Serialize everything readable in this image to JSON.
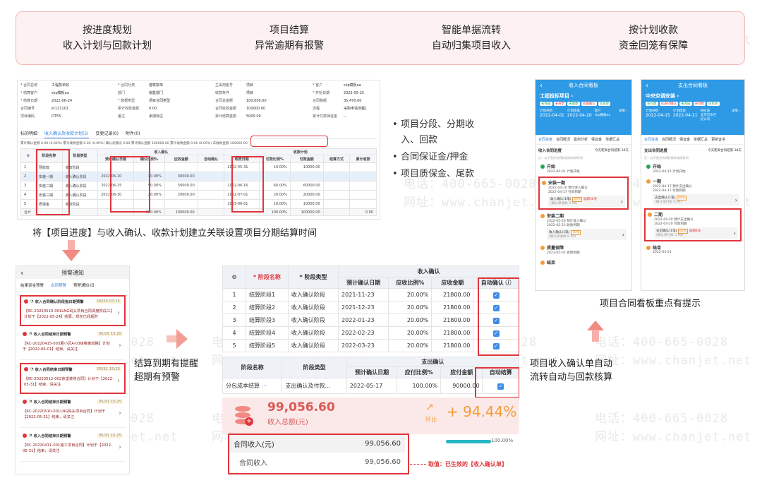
{
  "watermark": {
    "phone": "电话：400-665-0028",
    "site": "网址：www.chanjet.net"
  },
  "banner": {
    "features": [
      {
        "title": "按进度规划",
        "subtitle": "收入计划与回款计划"
      },
      {
        "title": "项目结算",
        "subtitle": "异常逾期有报警"
      },
      {
        "title": "智能单据流转",
        "subtitle": "自动归集项目收入"
      },
      {
        "title": "按计划收款",
        "subtitle": "资金回笼有保障"
      }
    ]
  },
  "contract_form": {
    "fields": [
      {
        "label": "* 合同名称",
        "value": "工程款单收"
      },
      {
        "label": "* 合同分类",
        "value": "建筑款单"
      },
      {
        "label": "主采用客号",
        "value": "项目"
      },
      {
        "label": "* 客户",
        "value": "skp模板aa"
      },
      {
        "label": "* 结算客户",
        "value": "skp模板aa"
      },
      {
        "label": "部门",
        "value": "销售部门"
      },
      {
        "label": "收款条件",
        "value": "项目"
      },
      {
        "label": "* 开始日期",
        "value": "2022-05-25"
      },
      {
        "label": "* 结算日期",
        "value": "2022-06-24"
      },
      {
        "label": "* 数据类型",
        "value": "项目合同类型"
      },
      {
        "label": "合同总金额",
        "value": "100,000.00"
      },
      {
        "label": "合同税额",
        "value": "35,470.00"
      },
      {
        "label": "合同编号",
        "value": "kt121101"
      },
      {
        "label": "累计收款金额",
        "value": "0.00"
      },
      {
        "label": "合同收款金额",
        "value": "100000.00"
      },
      {
        "label": "流程",
        "value": "采购申请流程1"
      },
      {
        "label": "项目编码",
        "value": "DT55"
      },
      {
        "label": "备注",
        "value": "添加标注"
      },
      {
        "label": "累计结算金额",
        "value": "5000.00"
      },
      {
        "label": "累计付款保证金",
        "value": "--"
      }
    ],
    "tabs": [
      "标的明细",
      "收入确认及收款计划(5)",
      "变更记录(0)",
      "附件(0)"
    ],
    "summary": "累计确认金额 0.00 (0.00%)  累计收款金额 0.00 (0.00%)  确认总额比 0.00  累计确认金额 100000.00  累计收款金额 0.00 (0.00%)  未收款金额 100000.00",
    "group_headers": {
      "confirm": "收入确认",
      "plan": "收款计划"
    },
    "columns": [
      "阶段名称",
      "阶段类型",
      "预计确认日期",
      "确认比例%",
      "应收金额",
      "自动确认",
      "收款日期",
      "付款比例%",
      "付款金额",
      "结算方式",
      "累计收款"
    ],
    "rows": [
      {
        "idx": "1",
        "name": "预收款",
        "type": "收款阶段",
        "date": "",
        "ratio": "",
        "amount": "",
        "pdate": "2022-05-31",
        "pratio": "10.00%",
        "pamount": "10000.00"
      },
      {
        "idx": "2",
        "name": "安装一期",
        "type": "收入确认阶段",
        "date": "2022-06-10",
        "ratio": "30.00%",
        "amount": "30000.00",
        "pdate": "",
        "pratio": "",
        "pamount": ""
      },
      {
        "idx": "3",
        "name": "安装二期",
        "type": "收入确认阶段",
        "date": "2022-06-15",
        "ratio": "50.00%",
        "amount": "50000.00",
        "pdate": "2022-06-16",
        "pratio": "60.00%",
        "pamount": "60000.00"
      },
      {
        "idx": "4",
        "name": "安装三期",
        "type": "收入确认阶段",
        "date": "2022-06-30",
        "ratio": "20.00%",
        "amount": "20000.00",
        "pdate": "2022-07-01",
        "pratio": "20.00%",
        "pamount": "20000.00"
      },
      {
        "idx": "5",
        "name": "质保金",
        "type": "收款阶段",
        "date": "",
        "ratio": "",
        "amount": "",
        "pdate": "2023-06-01",
        "pratio": "10.00%",
        "pamount": "10000.00"
      }
    ],
    "totals": {
      "label": "合计",
      "ratio": "100.00%",
      "amount": "100000.00",
      "pratio": "100.00%",
      "pamount": "100000.00",
      "received": "0.00"
    }
  },
  "bullets": [
    "项目分段、分期收入、回款",
    "合同保证金/押金",
    "项目质保金、尾款"
  ],
  "caption_link": "将【项目进度】与收入确认、收款计划建立关联设置项目分期结算时间",
  "alert_panel": {
    "title": "预警通知",
    "tabs": [
      "结果资金预警",
      "合同预警",
      "预警通知-旧"
    ],
    "items": [
      {
        "title": "收入合同确认阶段指日期预警",
        "time": "05/25 07:15",
        "body": "【RC-20220510-001LNG码头项目合同调度阶段二】计划于【2022-05-24】结算，现在已经超时"
      },
      {
        "title": "收入合同结束日期预警",
        "time": "05/25 15:25",
        "body": "【RC-20220415-003展小区A-03级楼盘道路】计划于【2022-06-01】结束，请关注"
      },
      {
        "title": "收入合同结束日期预警",
        "time": "05/31 15:25",
        "body": "【RC-20220512-002食堂装修合同】计划于【2022-05-31】结束，请关注"
      },
      {
        "title": "收入合同结束日期预警",
        "time": "05/31 15:25",
        "body": "【RC-20220510-001LNG码头项目合同】计划于【2022-05-31】结束，请关注"
      },
      {
        "title": "收入合同结束日期预警",
        "time": "05/31 15:25",
        "body": "【RC-20220411-001施工项目合同】计划于【2022-05-31】结束，请关注"
      }
    ]
  },
  "caption_alert": [
    "结算到期有提醒",
    "超期有预警"
  ],
  "income_table": {
    "group_header": "收入确认",
    "columns": [
      "阶段名称",
      "阶段类型",
      "预计确认日期",
      "应收比例%",
      "应收金额",
      "自动确认"
    ],
    "rows": [
      {
        "idx": "1",
        "name": "结算阶段1",
        "type": "收入确认阶段",
        "date": "2021-11-23",
        "ratio": "20.00%",
        "amount": "21800.00"
      },
      {
        "idx": "2",
        "name": "结算阶段2",
        "type": "收入确认阶段",
        "date": "2021-12-23",
        "ratio": "20.00%",
        "amount": "21800.00"
      },
      {
        "idx": "3",
        "name": "结算阶段3",
        "type": "收入确认阶段",
        "date": "2022-01-23",
        "ratio": "20.00%",
        "amount": "21800.00"
      },
      {
        "idx": "4",
        "name": "结算阶段4",
        "type": "收入确认阶段",
        "date": "2022-02-23",
        "ratio": "20.00%",
        "amount": "21800.00"
      },
      {
        "idx": "5",
        "name": "结算阶段5",
        "type": "收入确认阶段",
        "date": "2022-03-23",
        "ratio": "20.00%",
        "amount": "21800.00"
      }
    ]
  },
  "expense_table": {
    "group_header": "支出确认",
    "columns": [
      "阶段名称",
      "阶段类型",
      "预计确认日期",
      "应付比例%",
      "应付金额",
      "自动结算"
    ],
    "row": {
      "name": "分包成本结算",
      "type": "支出确认及付款...",
      "date": "2022-05-17",
      "ratio": "100.00%",
      "amount": "90000.00"
    }
  },
  "stats": {
    "amount": "99,056.60",
    "amount_label": "收入总额(元)",
    "ratio_label": "环比",
    "ratio": "+ 94.44%",
    "bar_value": "100.00%",
    "bar_fill": 1.0
  },
  "summary_box": {
    "rows": [
      {
        "label": "合同收入(元)",
        "value": "99,056.60"
      },
      {
        "label": "合同收入",
        "value": "99,056.60"
      }
    ],
    "note": "取值：已生效的【收入确认单】"
  },
  "caption_flow": [
    "项目收入确认单自动",
    "流转自动与回款核算"
  ],
  "caption_board": "项目合同看板重点有提示",
  "phone_income": {
    "title": "收入合同看板",
    "project": "工程投标项目 ›",
    "badges": [
      "未完成",
      "未开票",
      "未收款",
      "已收确认",
      "已生效"
    ],
    "start_label": "计划开始",
    "start": "2022-04-01",
    "end_label": "计划结束",
    "end": "2022-04-20",
    "client_label": "客户",
    "client": "skp模板aa",
    "detail": "详情 ›",
    "tabs": [
      "合同进度",
      "合同概况",
      "盈利分析",
      "保证金",
      "单据汇总"
    ],
    "progress_title": "收入合同进度",
    "progress_note": "今天距离合同结束-39天",
    "hint": "注：以下显示合同阶段的实际时间",
    "timeline": [
      {
        "name": "开始",
        "date": "2022-04-01",
        "desc": "计划开始"
      },
      {
        "name": "安装一期",
        "date": "2022-04-10",
        "desc": "预计收入确认",
        "date2": "2022-04-17",
        "desc2": "付款到期",
        "line": "收入确认(1笔)",
        "pct": "50%",
        "warn": "逾期30天",
        "sub": "(确认单收款 0.00)"
      },
      {
        "name": "安装二期",
        "date": "2022-05-20",
        "desc": "预计收入确认",
        "date2": "2022-05-23",
        "desc2": "收款到期",
        "line": "收入确认(1笔)",
        "pct": "70%",
        "sub": "(确认单收款 0.00)"
      },
      {
        "name": "质量保障",
        "date": "2023-05-01",
        "desc": "收款到期"
      },
      {
        "name": "结束",
        "date": "",
        "desc": ""
      }
    ]
  },
  "phone_expense": {
    "title": "支出合同看板",
    "project": "中央空调安装 ›",
    "badges": [
      "支付款",
      "已支付确认",
      "未完成",
      "未付款",
      "已生效"
    ],
    "start_label": "计划开始",
    "start": "2022-04-15",
    "end_label": "计划结束",
    "end": "2022-04-21",
    "client_label": "供应商",
    "client": "北京京东世纪公司",
    "detail": "详情 ›",
    "tabs": [
      "合同进度",
      "合同概况",
      "保证金",
      "单据汇总",
      "更新证书"
    ],
    "progress_title": "支出合同进度",
    "progress_note": "今天距离合同结束-38天",
    "hint": "注：以下显示合同阶段的实际时间",
    "timeline": [
      {
        "name": "开始",
        "date": "2022-04-15",
        "desc": "计划开始"
      },
      {
        "name": "一期",
        "date": "2022-04-17",
        "desc": "预计支出确认",
        "date2": "2022-04-17",
        "desc2": "付款到期",
        "line": "支出确认(1笔)",
        "pct": "60%",
        "sub": "(确认单付款 0.00)"
      },
      {
        "name": "二期",
        "date": "2022-04-20",
        "desc": "预计支出确认",
        "date2": "2022-04-20",
        "desc2": "付款到期",
        "line": "支出确认(1笔)",
        "pct": "60%",
        "warn": "逾期4天",
        "sub": "(确认单付款 0.00)"
      },
      {
        "name": "结束",
        "date": "2022-04-21",
        "desc": ""
      }
    ]
  }
}
